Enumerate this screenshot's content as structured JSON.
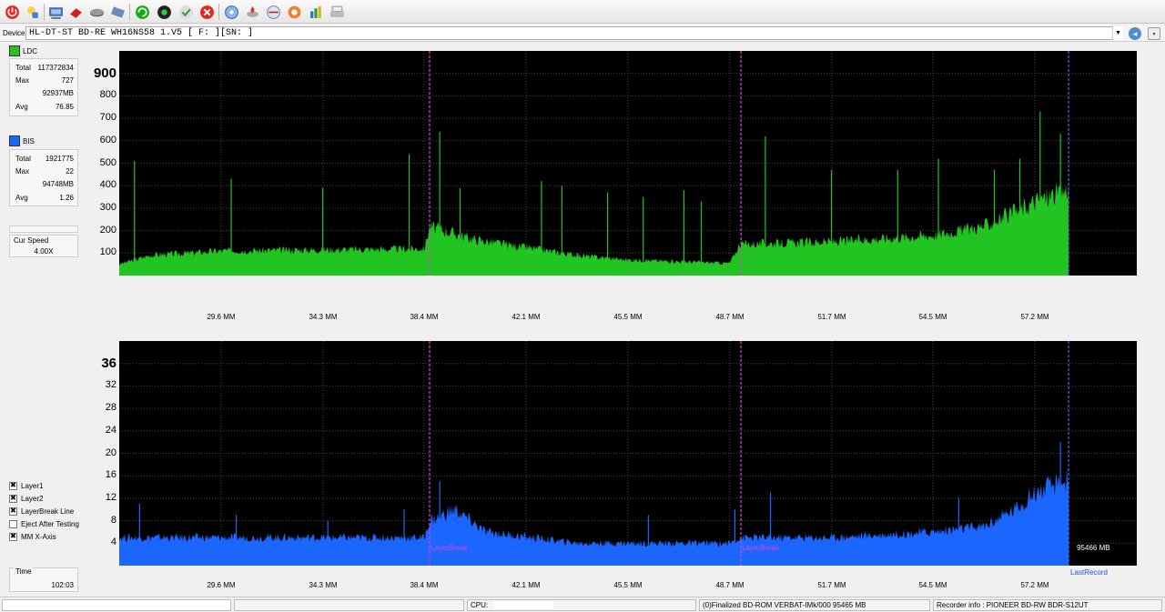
{
  "toolbar": {
    "icons": [
      "power-icon",
      "quick-info-icon",
      "drive-icon",
      "eraser-icon",
      "disc-icon",
      "settings-icon",
      "refresh-icon",
      "start-icon",
      "check-icon",
      "stop-icon",
      "scan-icon",
      "burn-icon",
      "compare-icon",
      "help-icon",
      "report-icon",
      "print-icon"
    ]
  },
  "device": {
    "label": "Device:",
    "value": "HL-DT-ST BD-RE  WH16NS58  1.V5 [ F: ][SN:                ]"
  },
  "ldc": {
    "legend": "LDC",
    "color": "#22c422",
    "stats": [
      {
        "k": "Total",
        "v": "117372834"
      },
      {
        "k": "Max",
        "v": "727"
      },
      {
        "k": "",
        "v": "92937MB"
      },
      {
        "k": "Avg",
        "v": "76.85"
      }
    ]
  },
  "bis": {
    "legend": "BIS",
    "color": "#1a66ff",
    "stats": [
      {
        "k": "Total",
        "v": "1921775"
      },
      {
        "k": "Max",
        "v": "22"
      },
      {
        "k": "",
        "v": "94748MB"
      },
      {
        "k": "Avg",
        "v": "1.26"
      }
    ]
  },
  "speed": {
    "label": "Cur Speed",
    "value": "4.00X"
  },
  "options": [
    {
      "label": "Layer1",
      "checked": true
    },
    {
      "label": "Layer2",
      "checked": true
    },
    {
      "label": "LayerBreak Line",
      "checked": true
    },
    {
      "label": "Eject After Testing",
      "checked": false
    },
    {
      "label": "MM X-Axis",
      "checked": true
    }
  ],
  "time": {
    "label": "Time",
    "value": "102:03"
  },
  "chart_data": [
    {
      "type": "area",
      "series": [
        {
          "name": "LDC",
          "color": "#22c422"
        }
      ],
      "yticks": [
        "900",
        "800",
        "700",
        "600",
        "500",
        "400",
        "300",
        "200",
        "100"
      ],
      "ylim": [
        0,
        1000
      ],
      "xticks": [
        "29.6 MM",
        "34.3 MM",
        "38.4 MM",
        "42.1 MM",
        "45.5 MM",
        "48.7 MM",
        "51.7 MM",
        "54.5 MM",
        "57.2 MM"
      ],
      "grid": true,
      "x_pct": [
        0,
        3,
        10,
        20,
        30,
        30.5,
        35,
        45,
        50,
        60,
        61,
        70,
        80,
        85,
        88,
        90,
        93,
        93.3
      ],
      "y": [
        50,
        90,
        110,
        115,
        120,
        220,
        160,
        90,
        70,
        55,
        140,
        150,
        180,
        220,
        280,
        330,
        380,
        400
      ],
      "spikes": [
        {
          "x_pct": 1.5,
          "y": 510
        },
        {
          "x_pct": 11,
          "y": 430
        },
        {
          "x_pct": 20,
          "y": 390
        },
        {
          "x_pct": 28.5,
          "y": 540
        },
        {
          "x_pct": 31.5,
          "y": 640
        },
        {
          "x_pct": 33.5,
          "y": 390
        },
        {
          "x_pct": 41.5,
          "y": 420
        },
        {
          "x_pct": 43.5,
          "y": 400
        },
        {
          "x_pct": 48,
          "y": 370
        },
        {
          "x_pct": 51.5,
          "y": 350
        },
        {
          "x_pct": 55.5,
          "y": 380
        },
        {
          "x_pct": 57.2,
          "y": 330
        },
        {
          "x_pct": 63.5,
          "y": 620
        },
        {
          "x_pct": 70,
          "y": 470
        },
        {
          "x_pct": 76.5,
          "y": 470
        },
        {
          "x_pct": 80.5,
          "y": 520
        },
        {
          "x_pct": 86,
          "y": 470
        },
        {
          "x_pct": 88.5,
          "y": 520
        },
        {
          "x_pct": 90.5,
          "y": 730
        },
        {
          "x_pct": 92.5,
          "y": 630
        }
      ],
      "layerbreaks_pct": [
        30.5,
        61.1
      ],
      "end_pct": 93.3
    },
    {
      "type": "area",
      "series": [
        {
          "name": "BIS",
          "color": "#1a66ff"
        }
      ],
      "yticks": [
        "36",
        "32",
        "28",
        "24",
        "20",
        "16",
        "12",
        "8",
        "4"
      ],
      "ylim": [
        0,
        40
      ],
      "xticks": [
        "29.6 MM",
        "34.3 MM",
        "38.4 MM",
        "42.1 MM",
        "45.5 MM",
        "48.7 MM",
        "51.7 MM",
        "54.5 MM",
        "57.2 MM"
      ],
      "grid": true,
      "x_pct": [
        0,
        10,
        20,
        30,
        30.5,
        33,
        36,
        45,
        55,
        60,
        61,
        70,
        80,
        85,
        88,
        90,
        93,
        93.3
      ],
      "y": [
        5,
        5,
        5,
        5,
        8,
        10,
        6,
        4,
        4,
        4,
        5,
        5,
        6,
        7,
        10,
        13,
        15,
        16
      ],
      "spikes": [
        {
          "x_pct": 2,
          "y": 11
        },
        {
          "x_pct": 11.5,
          "y": 9
        },
        {
          "x_pct": 20.5,
          "y": 8
        },
        {
          "x_pct": 28,
          "y": 10
        },
        {
          "x_pct": 31.5,
          "y": 15
        },
        {
          "x_pct": 52,
          "y": 9
        },
        {
          "x_pct": 60.5,
          "y": 10
        },
        {
          "x_pct": 64,
          "y": 13
        },
        {
          "x_pct": 82.5,
          "y": 12
        },
        {
          "x_pct": 92.5,
          "y": 22
        }
      ],
      "layerbreaks_pct": [
        30.5,
        61.1
      ],
      "layerbreak_label": "LayerBreak",
      "end_pct": 93.3,
      "end_value": "95466 MB",
      "end_label": "LastRecord"
    }
  ],
  "status": {
    "cpu_label": "CPU:",
    "disc_info": "(0)Finalized   BD-ROM   VERBAT-IMk/000   95465 MB",
    "recorder": "Recorder info : PIONEER        BD-RW   BDR-S12UT"
  }
}
